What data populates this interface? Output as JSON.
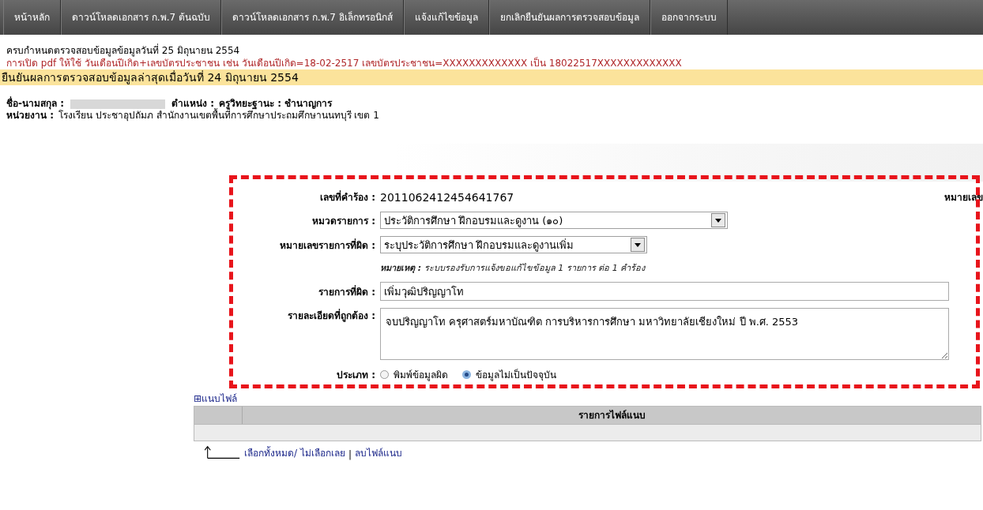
{
  "nav": {
    "items": [
      {
        "label": "หน้าหลัก",
        "selected": false
      },
      {
        "label": "ดาวน์โหลดเอกสาร ก.พ.7 ต้นฉบับ",
        "selected": false
      },
      {
        "label": "ดาวน์โหลดเอกสาร ก.พ.7 อิเล็กทรอนิกส์",
        "selected": false
      },
      {
        "label": "แจ้งแก้ไขข้อมูล",
        "selected": false
      },
      {
        "label": "ยกเลิกยืนยันผลการตรวจสอบข้อมูล",
        "selected": false
      },
      {
        "label": "ออกจากระบบ",
        "selected": false
      }
    ]
  },
  "notices": {
    "deadline": "ครบกำหนดตรวจสอบข้อมูลข้อมูลวันที่ 25 มิถุนายน 2554",
    "pdf_hint": "การเปิด pdf ให้ใช้ วันเดือนปีเกิด+เลขบัตรประชาชน เช่น วันเดือนปีเกิด=18-02-2517 เลขบัตรประชาชน=XXXXXXXXXXXXX เป็น 18022517XXXXXXXXXXXXX",
    "confirmed_banner": "ยืนยันผลการตรวจสอบข้อมูลล่าสุดเมื่อวันที่ 24 มิถุนายน 2554"
  },
  "profile": {
    "name_label": "ชื่อ-นามสกุล :",
    "position_label": "ตำแหน่ง :",
    "position": "ครูวิทยะฐานะ : ชำนาญการ",
    "unit_label": "หน่วยงาน :",
    "unit": "โรงเรียน ประชาอุปถัมภ สำนักงานเขตพื้นที่การศึกษาประถมศึกษานนทบุรี เขต 1"
  },
  "form": {
    "request_no_label": "เลขที่คำร้อง :",
    "request_no": "2011062412454641767",
    "right_label": "หมายเลข",
    "category_label": "หมวดรายการ :",
    "category": "ประวัติการศึกษา ฝึกอบรมและดูงาน (๑๐)",
    "item_no_label": "หมายเลขรายการที่ผิด :",
    "item_no": "ระบุประวัติการศึกษา ฝึกอบรมและดูงานเพิ่ม",
    "note": "**หมายเหตุ :** ระบบรองรับการแจ้งขอแก้ไขข้อมูล 1 รายการ ต่อ 1 คำร้อง",
    "wrong_item_label": "รายการที่ผิด :",
    "wrong_item": "เพิ่มวุฒิปริญญาโท",
    "correct_label": "รายละเอียดที่ถูกต้อง :",
    "correct": "จบปริญญาโท ครุศาสตร์มหาบัณฑิต การบริหารการศึกษา มหาวิทยาลัยเชียงใหม่ ปี พ.ศ. 2553",
    "type_label": "ประเภท :",
    "types": [
      {
        "label": "พิมพ์ข้อมูลผิด",
        "selected": false
      },
      {
        "label": "ข้อมูลไม่เป็นปัจจุบัน",
        "selected": true
      }
    ]
  },
  "attachments": {
    "toggle": "⊞แนบไฟล์",
    "column_header": "รายการไฟล์แนบ",
    "actions": [
      "เลือกทั้งหมด/",
      "ไม่เลือกเลย",
      "|",
      "ลบไฟล์แนบ"
    ]
  }
}
